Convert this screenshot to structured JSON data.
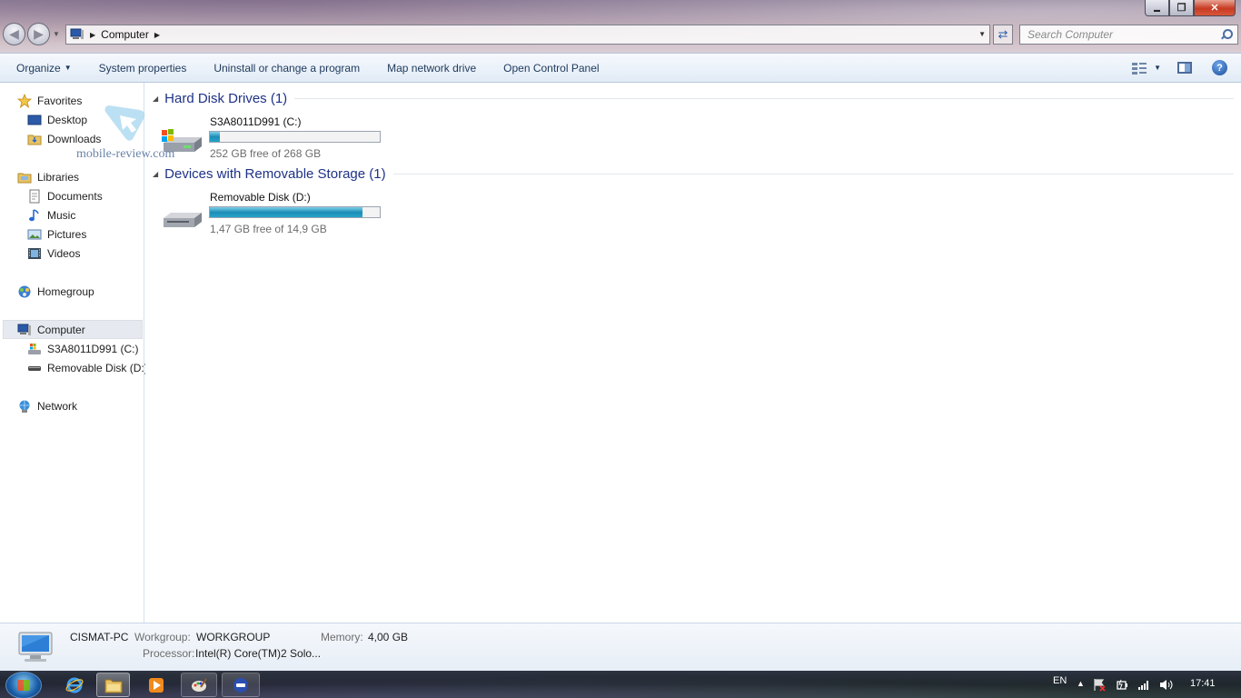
{
  "window": {
    "controls": {
      "minimize": "▬",
      "maximize": "❐",
      "close": "✕"
    }
  },
  "address_bar": {
    "location": "Computer",
    "search_placeholder": "Search Computer"
  },
  "command_bar": {
    "organize": "Organize",
    "items": [
      "System properties",
      "Uninstall or change a program",
      "Map network drive",
      "Open Control Panel"
    ]
  },
  "navigation": {
    "favorites": "Favorites",
    "desktop": "Desktop",
    "downloads": "Downloads",
    "libraries": "Libraries",
    "documents": "Documents",
    "music": "Music",
    "pictures": "Pictures",
    "videos": "Videos",
    "homegroup": "Homegroup",
    "computer": "Computer",
    "drive_c": "S3A8011D991 (C:)",
    "drive_d": "Removable Disk (D:)",
    "network": "Network"
  },
  "content": {
    "groups": [
      {
        "title": "Hard Disk Drives (1)",
        "drives": [
          {
            "name": "S3A8011D991 (C:)",
            "free_text": "252 GB free of 268 GB",
            "used_fraction": 0.06,
            "icon": "windows-drive-icon"
          }
        ]
      },
      {
        "title": "Devices with Removable Storage (1)",
        "drives": [
          {
            "name": "Removable Disk (D:)",
            "free_text": "1,47 GB free of 14,9 GB",
            "used_fraction": 0.9,
            "icon": "removable-drive-icon"
          }
        ]
      }
    ]
  },
  "watermark": "mobile-review.com",
  "details": {
    "computer_name": "CISMAT-PC",
    "workgroup_label": "Workgroup:",
    "workgroup_value": "WORKGROUP",
    "memory_label": "Memory:",
    "memory_value": "4,00 GB",
    "processor_label": "Processor:",
    "processor_value": "Intel(R) Core(TM)2 Solo..."
  },
  "taskbar": {
    "language": "EN",
    "clock": "17:41",
    "pinned": [
      "internet-explorer-icon",
      "windows-explorer-icon",
      "media-player-icon",
      "paint-icon",
      "app-icon"
    ]
  },
  "colors": {
    "group_title": "#1e3287",
    "command_text": "#1e395b",
    "bar_fill": "#1c8db6"
  }
}
